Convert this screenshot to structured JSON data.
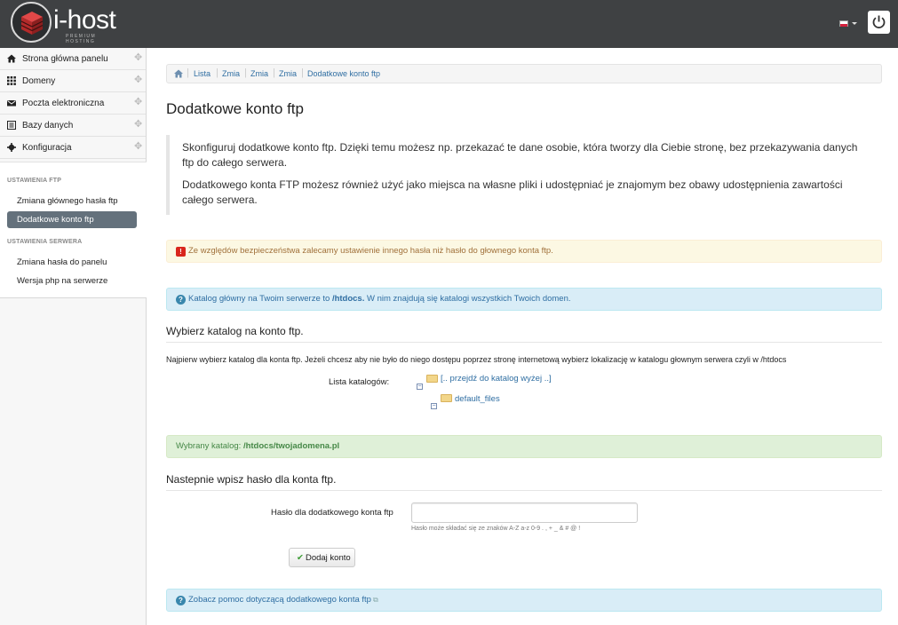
{
  "brand": {
    "name": "i-host",
    "tagline": "PREMIUM HOSTING"
  },
  "header": {
    "language_icon": "flag-pl-icon",
    "logout_icon": "power-icon"
  },
  "sidebar": {
    "nav": [
      {
        "label": "Strona główna panelu",
        "icon": "home-icon"
      },
      {
        "label": "Domeny",
        "icon": "grid-icon"
      },
      {
        "label": "Poczta elektroniczna",
        "icon": "envelope-icon"
      },
      {
        "label": "Bazy danych",
        "icon": "list-icon"
      },
      {
        "label": "Konfiguracja",
        "icon": "gear-icon"
      }
    ],
    "sections": [
      {
        "heading": "USTAWIENIA FTP",
        "links": [
          {
            "label": "Zmiana głównego hasła ftp",
            "active": false
          },
          {
            "label": "Dodatkowe konto ftp",
            "active": true
          }
        ]
      },
      {
        "heading": "USTAWIENIA SERWERA",
        "links": [
          {
            "label": "Zmiana hasła do panelu",
            "active": false
          },
          {
            "label": "Wersja php na serwerze",
            "active": false
          }
        ]
      }
    ]
  },
  "breadcrumb": [
    "Lista",
    "Zmia",
    "Zmia",
    "Zmia",
    "Dodatkowe konto ftp"
  ],
  "page": {
    "title": "Dodatkowe konto ftp",
    "intro_1": "Skonfiguruj dodatkowe konto ftp. Dzięki temu możesz np. przekazać te dane osobie, która tworzy dla Ciebie stronę, bez przekazywania danych ftp do całego serwera.",
    "intro_2": "Dodatkowego konta FTP możesz również użyć jako miejsca na własne pliki i udostępniać je znajomym bez obawy udostępnienia zawartości całego serwera.",
    "warning": "Ze względów bezpieczeństwa zalecamy ustawienie innego hasła niż hasło do głownego konta ftp.",
    "info_prefix": "Katalog główny na Twoim serwerze to ",
    "info_path": "/htdocs.",
    "info_suffix": " W nim znajdują się katalogi wszystkich Twoich domen.",
    "section1_title": "Wybierz katalog na konto ftp.",
    "section1_text": "Najpierw wybierz katalog dla konta ftp. Jeżeli chcesz aby nie było do niego dostępu poprzez stronę internetową wybierz lokalizację w katalogu głownym serwera czyli w /htdocs",
    "dir_list_label": "Lista katalogów:",
    "tree": {
      "up": "[.. przejdź do katalog wyżej ..]",
      "child": "default_files"
    },
    "selected_prefix": "Wybrany katalog: ",
    "selected_path": "/htdocs/twojadomena.pl",
    "section2_title": "Nastepnie wpisz hasło dla konta ftp.",
    "password_label": "Hasło dla dodatkowego konta ftp",
    "password_value": "",
    "password_hint": "Hasło może składać się ze znaków A-Z a-z 0-9 . , + _ & # @ !",
    "submit_label": "Dodaj konto",
    "help_link": "Zobacz pomoc dotyczącą dodatkowego konta ftp"
  }
}
